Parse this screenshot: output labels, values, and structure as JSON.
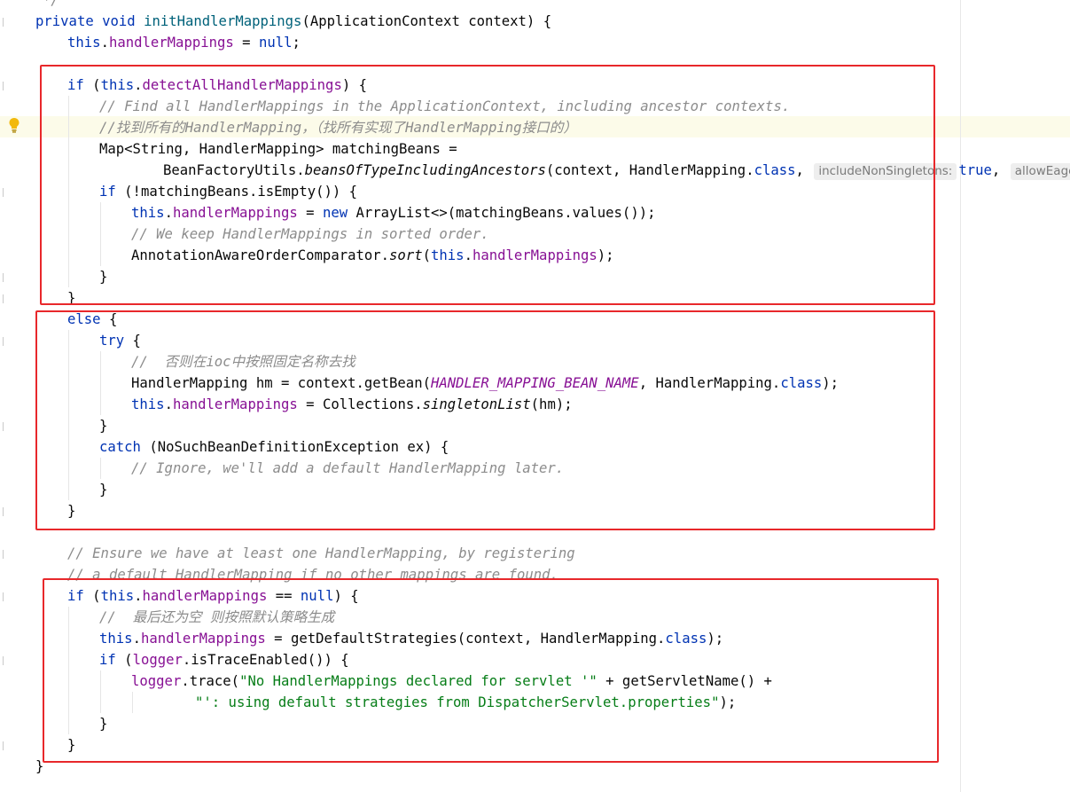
{
  "code": {
    "top_comment": "*/",
    "method_sig": {
      "kw_private": "private",
      "kw_void": "void",
      "name": "initHandlerMappings",
      "params": "(ApplicationContext context) {"
    },
    "l2": {
      "this": "this",
      "dot": ".",
      "field": "handlerMappings",
      "rest": " = ",
      "null": "null",
      ";": ";"
    },
    "l4": {
      "if": "if",
      "open": " (",
      "this": "this",
      "dot": ".",
      "field": "detectAllHandlerMappings",
      "close": ") {"
    },
    "l5": "// Find all HandlerMappings in the ApplicationContext, including ancestor contexts.",
    "l6": "//找到所有的HandlerMapping，（找所有实现了HandlerMapping接口的）",
    "l7": "Map<String, HandlerMapping> matchingBeans =",
    "l8": {
      "pre": "BeanFactoryUtils.",
      "method": "beansOfTypeIncludingAncestors",
      "args": "(context, HandlerMapping.",
      "class": "class",
      "comma": ",",
      "hint1": "includeNonSingletons:",
      "true": "true",
      "comma2": ",",
      "hint2": "allowEagerInit"
    },
    "l9": {
      "if": "if",
      "rest": " (!matchingBeans.isEmpty()) {"
    },
    "l10": {
      "this": "this",
      "field": "handlerMappings",
      "eq": " = ",
      "new": "new",
      "rest": " ArrayList<>(matchingBeans.values());"
    },
    "l11": "// We keep HandlerMappings in sorted order.",
    "l12": {
      "pre": "AnnotationAwareOrderComparator.",
      "method": "sort",
      "open": "(",
      "this": "this",
      "field": "handlerMappings",
      "close": ");"
    },
    "l13": "}",
    "l14": "}",
    "l15": {
      "else": "else",
      "rest": " {"
    },
    "l16": {
      "try": "try",
      "rest": " {"
    },
    "l17": "//  否则在ioc中按照固定名称去找",
    "l18": {
      "pre": "HandlerMapping hm = context.getBean(",
      "const": "HANDLER_MAPPING_BEAN_NAME",
      "mid": ", HandlerMapping.",
      "class": "class",
      "end": ");"
    },
    "l19": {
      "this": "this",
      "field": "handlerMappings",
      "eq": " = Collections.",
      "method": "singletonList",
      "end": "(hm);"
    },
    "l20": "}",
    "l21": {
      "catch": "catch",
      "rest": " (NoSuchBeanDefinitionException ex) {"
    },
    "l22": "// Ignore, we'll add a default HandlerMapping later.",
    "l23": "}",
    "l24": "}",
    "l26": "// Ensure we have at least one HandlerMapping, by registering",
    "l27": "// a default HandlerMapping if no other mappings are found.",
    "l28": {
      "if": "if",
      "open": " (",
      "this": "this",
      "field": "handlerMappings",
      "eq": " == ",
      "null": "null",
      "close": ") {"
    },
    "l29": "//  最后还为空 则按照默认策略生成",
    "l30": {
      "this": "this",
      "field": "handlerMappings",
      "eq": " = getDefaultStrategies(context, HandlerMapping.",
      "class": "class",
      "end": ");"
    },
    "l31": {
      "if": "if",
      "open": " (",
      "logger": "logger",
      "rest": ".isTraceEnabled()) {"
    },
    "l32": {
      "logger": "logger",
      "mid": ".trace(",
      "str": "\"No HandlerMappings declared for servlet '\"",
      "end": " + getServletName() +"
    },
    "l33": {
      "str": "\"': using default strategies from DispatcherServlet.properties\"",
      "end": ");"
    },
    "l34": "}",
    "l35": "}",
    "l36": "}"
  },
  "icons": {
    "intention": "lightbulb-icon"
  },
  "colors": {
    "keyword": "#0033b3",
    "field": "#871094",
    "comment": "#8c8c8c",
    "string": "#067d17",
    "highlight_box": "#e8282b",
    "caret_line": "#fcfbe9"
  }
}
